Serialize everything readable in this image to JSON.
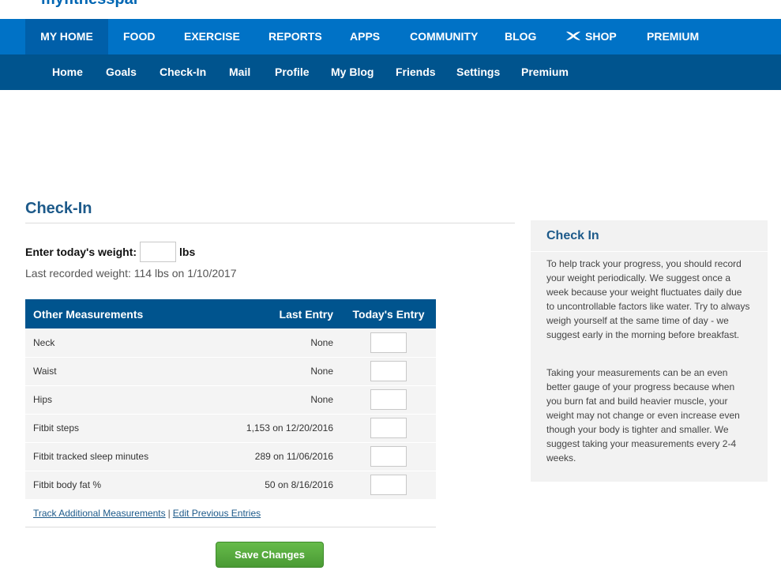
{
  "brand": {
    "logo_text": "myfitnesspal"
  },
  "main_nav": {
    "items": [
      "MY HOME",
      "FOOD",
      "EXERCISE",
      "REPORTS",
      "APPS",
      "COMMUNITY",
      "BLOG",
      "SHOP",
      "PREMIUM"
    ],
    "active": "MY HOME",
    "shop_icon": "under-armour-icon"
  },
  "sub_nav": {
    "items": [
      "Home",
      "Goals",
      "Check-In",
      "Mail",
      "Profile",
      "My Blog",
      "Friends",
      "Settings",
      "Premium"
    ],
    "active": "Check-In"
  },
  "page": {
    "title": "Check-In",
    "weight_label": "Enter today's weight:",
    "weight_value": "",
    "weight_unit": "lbs",
    "last_recorded": "Last recorded weight: 114 lbs on 1/10/2017"
  },
  "measurements": {
    "headers": [
      "Other Measurements",
      "Last Entry",
      "Today's Entry"
    ],
    "rows": [
      {
        "name": "Neck",
        "last": "None"
      },
      {
        "name": "Waist",
        "last": "None"
      },
      {
        "name": "Hips",
        "last": "None"
      },
      {
        "name": "Fitbit steps",
        "last": "1,153 on 12/20/2016"
      },
      {
        "name": "Fitbit tracked sleep minutes",
        "last": "289 on 11/06/2016"
      },
      {
        "name": "Fitbit body fat %",
        "last": "50 on 8/16/2016"
      }
    ],
    "links": {
      "track": "Track Additional Measurements",
      "separator": "|",
      "edit": "Edit Previous Entries"
    },
    "save_label": "Save Changes"
  },
  "sidebar": {
    "title": "Check In",
    "paragraph1": "To help track your progress, you should record your weight periodically. We suggest once a week because your weight fluctuates daily due to uncontrollable factors like water. Try to always weigh yourself at the same time of day - we suggest early in the morning before breakfast.",
    "paragraph2": "Taking your measurements can be an even better gauge of your progress because when you burn fat and build heavier muscle, your weight may not change or even increase even though your body is tighter and smaller. We suggest taking your measurements every 2-4 weeks."
  },
  "colors": {
    "main_nav_bg": "#0072c6",
    "sub_nav_bg": "#00548e",
    "title_blue": "#1d5a8a",
    "save_green": "#5aab3f"
  }
}
